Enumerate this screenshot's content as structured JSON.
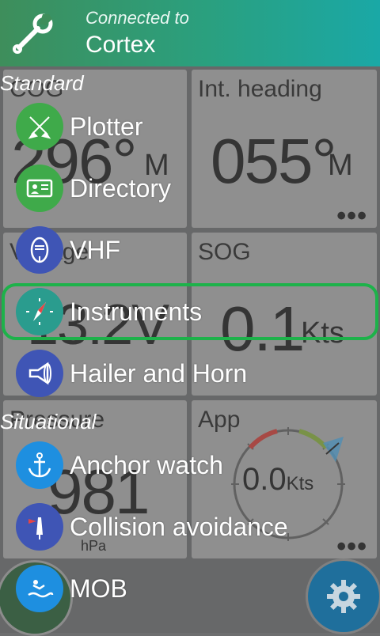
{
  "header": {
    "title": "Connected to",
    "device": "Cortex",
    "icon": "wrench-icon"
  },
  "tiles": {
    "cog": {
      "label": "COG",
      "value": "296°",
      "unit": "M"
    },
    "heading": {
      "label": "Int. heading",
      "value": "055°",
      "unit": "M"
    },
    "voltage": {
      "label": "Voltage",
      "value": "13.2V"
    },
    "sog": {
      "label": "SOG",
      "value": "0.1",
      "unit": "Kts"
    },
    "pressure": {
      "label": "Pressure",
      "value": "981",
      "unit": "hPa"
    },
    "wind": {
      "label": "App",
      "value": "0.0",
      "unit": "Kts"
    }
  },
  "menu": {
    "standard_label": "Standard",
    "situational_label": "Situational",
    "items": [
      {
        "label": "Plotter",
        "icon": "plotter-icon",
        "color": "#3faa4a"
      },
      {
        "label": "Directory",
        "icon": "directory-icon",
        "color": "#3faa4a"
      },
      {
        "label": "VHF",
        "icon": "vhf-radio-icon",
        "color": "#3f55b5"
      },
      {
        "label": "Instruments",
        "icon": "compass-icon",
        "color": "#2a9c8e"
      },
      {
        "label": "Hailer and Horn",
        "icon": "megaphone-icon",
        "color": "#3f55b5"
      },
      {
        "label": "Anchor watch",
        "icon": "anchor-icon",
        "color": "#1e8fe0"
      },
      {
        "label": "Collision avoidance",
        "icon": "collision-icon",
        "color": "#3f55b5"
      },
      {
        "label": "MOB",
        "icon": "man-overboard-icon",
        "color": "#1e8fe0"
      }
    ]
  },
  "selected": "Instruments",
  "fab": {
    "left_icon": "home-icon",
    "right_icon": "gear-icon"
  }
}
